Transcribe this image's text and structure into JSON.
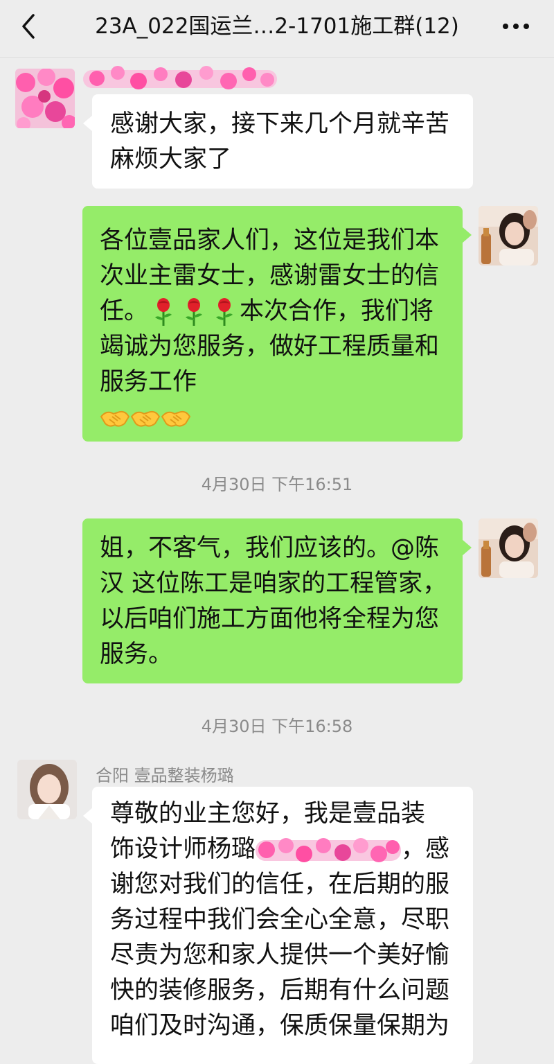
{
  "header": {
    "title": "23A_022国运兰…2-1701施工群(12)",
    "back_icon": "chevron-left-icon",
    "more_icon": "ellipsis-icon"
  },
  "messages": [
    {
      "side": "left",
      "text": "感谢大家，接下来几个月就辛苦\n麻烦大家了"
    },
    {
      "side": "right",
      "text_line1": "各位壹品家人们，这位是我们本\n次业主雷女士，感谢雷女士的信\n任。",
      "emoji_roses": [
        "rose-icon",
        "rose-icon",
        "rose-icon"
      ],
      "text_line2": "本次合作，我们将",
      "text_line3": "竭诚为您服务，做好工程质量和\n服务工作",
      "emoji_handshakes": [
        "handshake-icon",
        "handshake-icon",
        "handshake-icon"
      ]
    },
    {
      "side": "right",
      "text": "姐，不客气，我们应该的。@陈\n汉  这位陈工是咱家的工程管家，\n以后咱们施工方面他将全程为您\n服务。"
    },
    {
      "side": "left",
      "sender": "合阳 壹品整装杨璐",
      "text_a": "  尊敬的业主您好，我是壹品装\n饰设计师杨璐",
      "text_b": "，感",
      "text_c": "谢您对我们的信任，在后期的服\n务过程中我们会全心全意，尽职\n尽责为您和家人提供一个美好愉\n快的装修服务，后期有什么问题\n咱们及时沟通，保质保量保期为"
    }
  ],
  "timestamps": [
    "4月30日 下午16:51",
    "4月30日 下午16:58"
  ],
  "colors": {
    "background": "#ededed",
    "bubble_self": "#95ec69",
    "bubble_other": "#ffffff",
    "meta_text": "#8a8a8a"
  }
}
